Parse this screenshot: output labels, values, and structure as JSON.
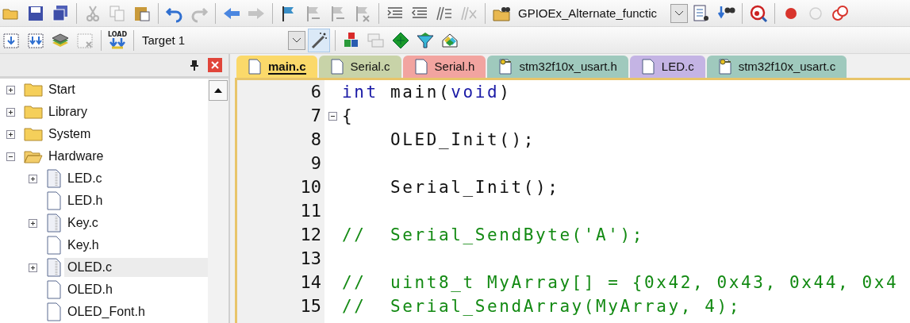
{
  "toolbar_top": {
    "items": [
      {
        "kind": "open",
        "disabled": false
      },
      {
        "kind": "save",
        "disabled": false
      },
      {
        "kind": "save-all",
        "disabled": false
      },
      {
        "kind": "sep"
      },
      {
        "kind": "cut",
        "disabled": true
      },
      {
        "kind": "copy",
        "disabled": true
      },
      {
        "kind": "paste",
        "disabled": false
      },
      {
        "kind": "sep"
      },
      {
        "kind": "undo",
        "disabled": false
      },
      {
        "kind": "redo",
        "disabled": true
      },
      {
        "kind": "sep"
      },
      {
        "kind": "back",
        "disabled": false
      },
      {
        "kind": "forward",
        "disabled": true
      },
      {
        "kind": "sep"
      },
      {
        "kind": "flag",
        "disabled": false
      },
      {
        "kind": "flag-prev",
        "disabled": true
      },
      {
        "kind": "flag-next",
        "disabled": true
      },
      {
        "kind": "flag-clear",
        "disabled": true
      },
      {
        "kind": "sep"
      },
      {
        "kind": "indent",
        "disabled": false
      },
      {
        "kind": "unindent",
        "disabled": false
      },
      {
        "kind": "comment",
        "disabled": false
      },
      {
        "kind": "uncomment",
        "disabled": true
      },
      {
        "kind": "sep"
      },
      {
        "kind": "find-folder",
        "disabled": false
      },
      {
        "kind": "combo",
        "text": "GPIOEx_Alternate_functic"
      },
      {
        "kind": "find-doc",
        "disabled": false
      },
      {
        "kind": "binoculars",
        "disabled": false
      },
      {
        "kind": "sep"
      },
      {
        "kind": "debug",
        "disabled": false
      },
      {
        "kind": "sep"
      },
      {
        "kind": "breakpoint",
        "disabled": false
      },
      {
        "kind": "breakpoint-off",
        "disabled": true
      },
      {
        "kind": "breakpoints",
        "disabled": false
      }
    ]
  },
  "toolbar_build": {
    "items": [
      {
        "kind": "build",
        "disabled": false
      },
      {
        "kind": "rebuild",
        "disabled": false
      },
      {
        "kind": "batch",
        "disabled": false
      },
      {
        "kind": "stop",
        "disabled": true
      },
      {
        "kind": "sep"
      },
      {
        "kind": "load",
        "text": "LOAD",
        "disabled": false
      },
      {
        "kind": "sep"
      },
      {
        "kind": "target",
        "text": "Target 1"
      },
      {
        "kind": "options",
        "pressed": true,
        "disabled": false
      },
      {
        "kind": "sep"
      },
      {
        "kind": "components",
        "disabled": false
      },
      {
        "kind": "windows",
        "disabled": true
      },
      {
        "kind": "diamond",
        "disabled": false
      },
      {
        "kind": "funnel",
        "disabled": false
      },
      {
        "kind": "pack",
        "disabled": false
      }
    ]
  },
  "project_panel": {
    "tree": [
      {
        "label": "Start",
        "kind": "folder",
        "expanded": false,
        "selected": false
      },
      {
        "label": "Library",
        "kind": "folder",
        "expanded": false,
        "selected": false
      },
      {
        "label": "System",
        "kind": "folder",
        "expanded": false,
        "selected": false
      },
      {
        "label": "Hardware",
        "kind": "folder",
        "expanded": true,
        "selected": false,
        "children": [
          {
            "label": "LED.c",
            "kind": "source",
            "expanded": false,
            "selected": false
          },
          {
            "label": "LED.h",
            "kind": "header",
            "selected": false
          },
          {
            "label": "Key.c",
            "kind": "source",
            "expanded": false,
            "selected": false
          },
          {
            "label": "Key.h",
            "kind": "header",
            "selected": false
          },
          {
            "label": "OLED.c",
            "kind": "source",
            "expanded": false,
            "selected": true
          },
          {
            "label": "OLED.h",
            "kind": "header",
            "selected": false
          },
          {
            "label": "OLED_Font.h",
            "kind": "header",
            "selected": false
          }
        ]
      }
    ]
  },
  "editor_tabs": [
    {
      "label": "main.c",
      "kind": "file",
      "color": "#fbd96a",
      "selected": true
    },
    {
      "label": "Serial.c",
      "kind": "file",
      "color": "#c8d3a8",
      "selected": false
    },
    {
      "label": "Serial.h",
      "kind": "file",
      "color": "#f2a4a0",
      "selected": false
    },
    {
      "label": "stm32f10x_usart.h",
      "kind": "key-file",
      "color": "#9fc9bd",
      "selected": false
    },
    {
      "label": "LED.c",
      "kind": "file",
      "color": "#c4b4e4",
      "selected": false
    },
    {
      "label": "stm32f10x_usart.c",
      "kind": "key-file",
      "color": "#9fc9bd",
      "selected": false
    }
  ],
  "code_lines": [
    {
      "number": "6",
      "tokens": [
        {
          "kind": "keyword",
          "text": "int"
        },
        {
          "kind": "plain",
          "text": " main("
        },
        {
          "kind": "keyword",
          "text": "void"
        },
        {
          "kind": "plain",
          "text": ")"
        }
      ]
    },
    {
      "number": "7",
      "folded": false,
      "tokens": [
        {
          "kind": "plain",
          "text": "{"
        }
      ]
    },
    {
      "number": "8",
      "tokens": [
        {
          "kind": "plain",
          "text": "    OLED_Init();"
        }
      ]
    },
    {
      "number": "9"
    },
    {
      "number": "10",
      "tokens": [
        {
          "kind": "plain",
          "text": "    Serial_Init();"
        }
      ]
    },
    {
      "number": "11"
    },
    {
      "number": "12",
      "tokens": [
        {
          "kind": "comment",
          "text": "//  Serial_SendByte('A');"
        }
      ]
    },
    {
      "number": "13"
    },
    {
      "number": "14",
      "tokens": [
        {
          "kind": "comment",
          "text": "//  uint8_t MyArray[] = {0x42, 0x43, 0x44, 0x4"
        }
      ]
    },
    {
      "number": "15",
      "tokens": [
        {
          "kind": "comment",
          "text": "//  Serial_SendArray(MyArray, 4);"
        }
      ]
    }
  ]
}
